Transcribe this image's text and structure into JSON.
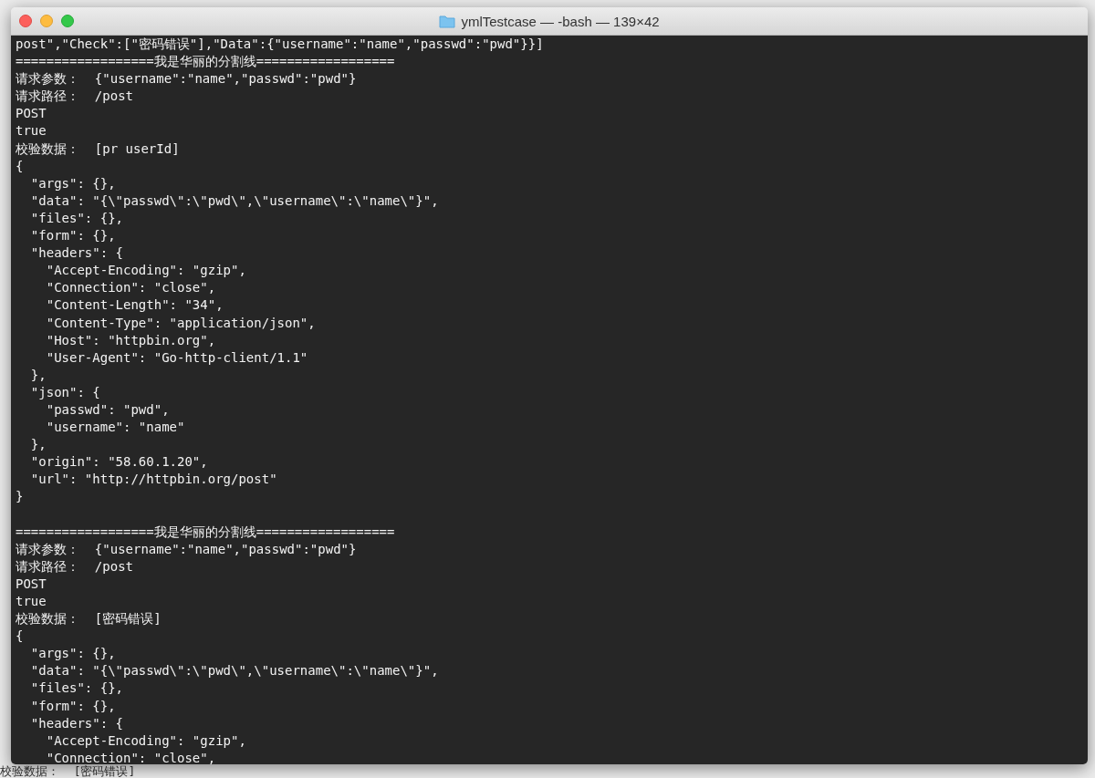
{
  "window": {
    "title": "ymlTestcase — -bash — 139×42"
  },
  "terminal": {
    "blocks": [
      {
        "lines": [
          "post\",\"Check\":[\"密码错误\"],\"Data\":{\"username\":\"name\",\"passwd\":\"pwd\"}}]",
          "==================我是华丽的分割线==================",
          "请求参数：  {\"username\":\"name\",\"passwd\":\"pwd\"}",
          "请求路径：  /post",
          "POST",
          "true",
          "校验数据：  [pr userId]",
          "{",
          "  \"args\": {},",
          "  \"data\": \"{\\\"passwd\\\":\\\"pwd\\\",\\\"username\\\":\\\"name\\\"}\",",
          "  \"files\": {},",
          "  \"form\": {},",
          "  \"headers\": {",
          "    \"Accept-Encoding\": \"gzip\",",
          "    \"Connection\": \"close\",",
          "    \"Content-Length\": \"34\",",
          "    \"Content-Type\": \"application/json\",",
          "    \"Host\": \"httpbin.org\",",
          "    \"User-Agent\": \"Go-http-client/1.1\"",
          "  },",
          "  \"json\": {",
          "    \"passwd\": \"pwd\",",
          "    \"username\": \"name\"",
          "  },",
          "  \"origin\": \"58.60.1.20\",",
          "  \"url\": \"http://httpbin.org/post\"",
          "}"
        ]
      },
      {
        "lines": [
          "==================我是华丽的分割线==================",
          "请求参数：  {\"username\":\"name\",\"passwd\":\"pwd\"}",
          "请求路径：  /post",
          "POST",
          "true",
          "校验数据：  [密码错误]",
          "{",
          "  \"args\": {},",
          "  \"data\": \"{\\\"passwd\\\":\\\"pwd\\\",\\\"username\\\":\\\"name\\\"}\",",
          "  \"files\": {},",
          "  \"form\": {},",
          "  \"headers\": {",
          "    \"Accept-Encoding\": \"gzip\",",
          "    \"Connection\": \"close\","
        ]
      }
    ]
  },
  "editor_behind": {
    "output_line": "校验数据：  [密码错误]"
  }
}
